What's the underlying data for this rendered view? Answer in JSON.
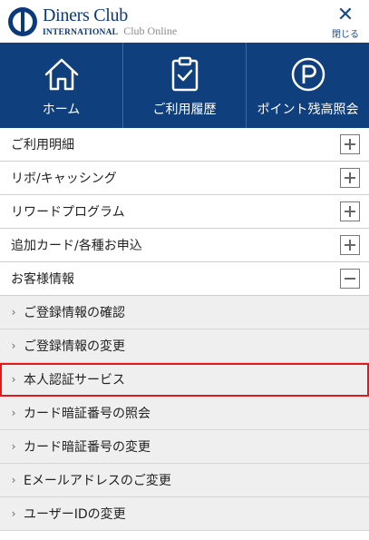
{
  "header": {
    "brand_title": "Diners Club",
    "brand_sub": "INTERNATIONAL",
    "brand_online": "Club Online",
    "close_glyph": "✕",
    "close_label": "閉じる"
  },
  "tiles": [
    {
      "label": "ホーム",
      "icon": "home-icon"
    },
    {
      "label": "ご利用履歴",
      "icon": "clipboard-check-icon"
    },
    {
      "label": "ポイント残高照会",
      "icon": "points-p-icon"
    }
  ],
  "menu": [
    {
      "label": "ご利用明細",
      "state": "collapsed"
    },
    {
      "label": "リボ/キャッシング",
      "state": "collapsed"
    },
    {
      "label": "リワードプログラム",
      "state": "collapsed"
    },
    {
      "label": "追加カード/各種お申込",
      "state": "collapsed"
    },
    {
      "label": "お客様情報",
      "state": "expanded"
    }
  ],
  "submenu": [
    {
      "label": "ご登録情報の確認"
    },
    {
      "label": "ご登録情報の変更"
    },
    {
      "label": "本人認証サービス",
      "highlighted": true
    },
    {
      "label": "カード暗証番号の照会"
    },
    {
      "label": "カード暗証番号の変更"
    },
    {
      "label": "Eメールアドレスのご変更"
    },
    {
      "label": "ユーザーIDの変更"
    }
  ],
  "colors": {
    "brand_blue": "#0f3f7d",
    "highlight_red": "#e11b1b",
    "submenu_bg": "#efefef"
  }
}
